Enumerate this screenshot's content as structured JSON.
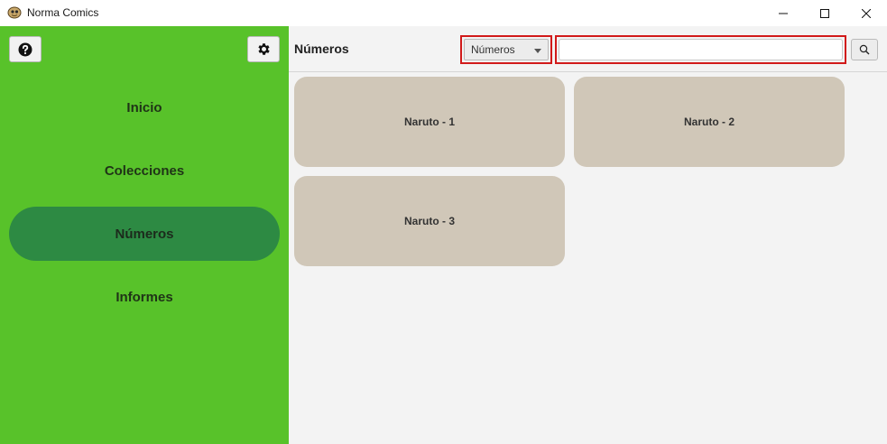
{
  "window": {
    "title": "Norma Comics",
    "icon": "comic-app-icon",
    "controls": [
      "minimize-icon",
      "maximize-icon",
      "close-icon"
    ]
  },
  "sidebar": {
    "background": "#58c22a",
    "active_background": "#2d8a43",
    "top_buttons": [
      {
        "icon": "help-icon"
      },
      {
        "icon": "gear-icon"
      }
    ],
    "items": [
      {
        "label": "Inicio",
        "active": false
      },
      {
        "label": "Colecciones",
        "active": false
      },
      {
        "label": "Números",
        "active": true
      },
      {
        "label": "Informes",
        "active": false
      }
    ]
  },
  "header": {
    "title": "Números",
    "filter": {
      "selected": "Números"
    },
    "search": {
      "value": "",
      "placeholder": ""
    },
    "search_button_icon": "search-icon",
    "highlight_color": "#d11a1a"
  },
  "cards": [
    {
      "label": "Naruto - 1"
    },
    {
      "label": "Naruto - 2"
    },
    {
      "label": "Naruto - 3"
    }
  ],
  "card_color": "#d0c7b8"
}
